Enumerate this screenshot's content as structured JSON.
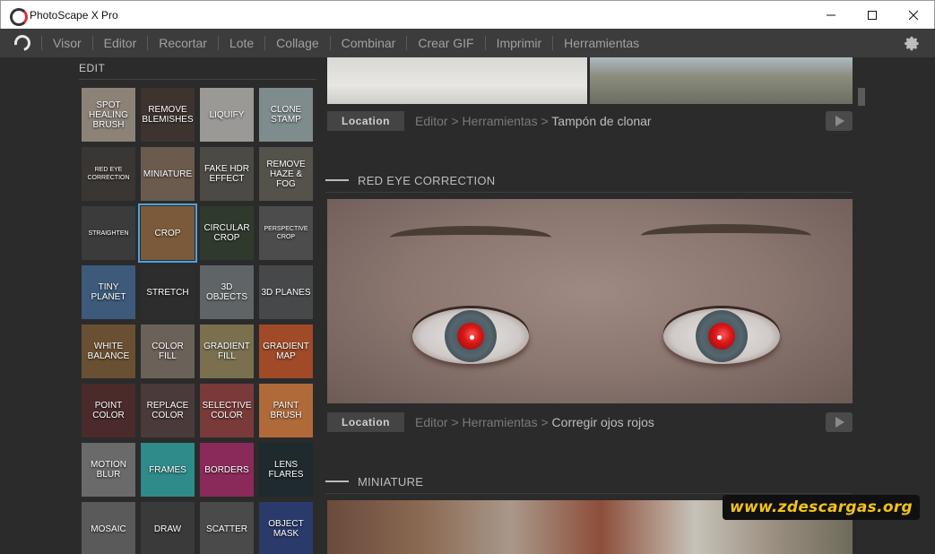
{
  "window": {
    "title": "PhotoScape X Pro",
    "controls": {
      "minimize": "minimize-icon",
      "maximize": "maximize-icon",
      "close": "close-icon"
    }
  },
  "menu": {
    "items": [
      "Visor",
      "Editor",
      "Recortar",
      "Lote",
      "Collage",
      "Combinar",
      "Crear GIF",
      "Imprimir",
      "Herramientas"
    ],
    "settings_icon": "gear-icon"
  },
  "sidebar": {
    "heading": "EDIT",
    "tiles": [
      {
        "label": "SPOT HEALING BRUSH",
        "bg": "#8c8276"
      },
      {
        "label": "REMOVE BLEMISHES",
        "bg": "#3d3430"
      },
      {
        "label": "LIQUIFY",
        "bg": "#9a9996"
      },
      {
        "label": "CLONE STAMP",
        "bg": "#7f8c8e"
      },
      {
        "label": "RED EYE CORRECTION",
        "bg": "#3a3633",
        "small": true
      },
      {
        "label": "MINIATURE",
        "bg": "#6b5a4e"
      },
      {
        "label": "FAKE HDR EFFECT",
        "bg": "#4b4a44"
      },
      {
        "label": "REMOVE HAZE & FOG",
        "bg": "#55524b"
      },
      {
        "label": "STRAIGHTEN",
        "bg": "#3b3b3b",
        "small": true
      },
      {
        "label": "CROP",
        "bg": "#7a5a3a",
        "selected": true
      },
      {
        "label": "CIRCULAR CROP",
        "bg": "#2f3a2c"
      },
      {
        "label": "PERSPECTIVE CROP",
        "bg": "#4c4c4c",
        "small": true
      },
      {
        "label": "TINY PLANET",
        "bg": "#3d5a7a"
      },
      {
        "label": "STRETCH",
        "bg": "#2d2d2d"
      },
      {
        "label": "3D OBJECTS",
        "bg": "#5f6466"
      },
      {
        "label": "3D PLANES",
        "bg": "#46484a"
      },
      {
        "label": "WHITE BALANCE",
        "bg": "#6a5032"
      },
      {
        "label": "COLOR FILL",
        "bg": "#6a6258"
      },
      {
        "label": "GRADIENT FILL",
        "bg": "#7a7050"
      },
      {
        "label": "GRADIENT MAP",
        "bg": "#a04a28"
      },
      {
        "label": "POINT COLOR",
        "bg": "#4a2a2a"
      },
      {
        "label": "REPLACE COLOR",
        "bg": "#4a3a3a"
      },
      {
        "label": "SELECTIVE COLOR",
        "bg": "#7a3a3a"
      },
      {
        "label": "PAINT BRUSH",
        "bg": "#b06a3a"
      },
      {
        "label": "MOTION BLUR",
        "bg": "#6a6a6a"
      },
      {
        "label": "FRAMES",
        "bg": "#2f8a8a"
      },
      {
        "label": "BORDERS",
        "bg": "#8a2a5a"
      },
      {
        "label": "LENS FLARES",
        "bg": "#1e2a2e"
      },
      {
        "label": "MOSAIC",
        "bg": "#5a5a5a"
      },
      {
        "label": "DRAW",
        "bg": "#3a3a3a"
      },
      {
        "label": "SCATTER",
        "bg": "#4a4a4a"
      },
      {
        "label": "OBJECT MASK",
        "bg": "#2a3a6a"
      }
    ]
  },
  "content": {
    "clone_row": {
      "location_label": "Location",
      "path_editor": "Editor",
      "path_sep": ">",
      "path_tools": "Herramientas",
      "path_current": "Tampón de clonar"
    },
    "red_eye_section": {
      "title": "RED EYE CORRECTION",
      "location_label": "Location",
      "path_editor": "Editor",
      "path_sep": ">",
      "path_tools": "Herramientas",
      "path_current": "Corregir ojos rojos"
    },
    "miniature_section": {
      "title": "MINIATURE"
    }
  },
  "watermark": "www.zdescargas.org"
}
